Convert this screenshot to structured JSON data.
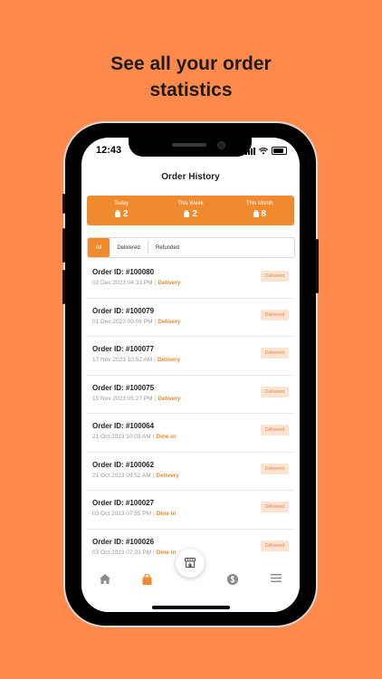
{
  "headline": {
    "line1": "See all your order",
    "line2": "statistics"
  },
  "status_bar": {
    "time": "12:43"
  },
  "page": {
    "title": "Order History"
  },
  "stats": [
    {
      "label": "Today",
      "value": "2"
    },
    {
      "label": "This Week",
      "value": "2"
    },
    {
      "label": "This Month",
      "value": "8"
    }
  ],
  "filter_tabs": [
    {
      "label": "All",
      "active": true
    },
    {
      "label": "Delivered",
      "active": false
    },
    {
      "label": "Refunded",
      "active": false
    }
  ],
  "orders": [
    {
      "id": "Order ID: #100080",
      "datetime": "02 Dec 2023  04:33 PM",
      "type": "Delivery",
      "status": "Delivered"
    },
    {
      "id": "Order ID: #100079",
      "datetime": "01 Dec 2023  09:06 PM",
      "type": "Delivery",
      "status": "Delivered"
    },
    {
      "id": "Order ID: #100077",
      "datetime": "17 Nov 2023  10:52 AM",
      "type": "Delivery",
      "status": "Delivered"
    },
    {
      "id": "Order ID: #100075",
      "datetime": "15 Nov 2023  05:27 PM",
      "type": "Delivery",
      "status": "Delivered"
    },
    {
      "id": "Order ID: #100064",
      "datetime": "21 Oct 2023  10:03 AM",
      "type": "Dine in",
      "status": "Delivered"
    },
    {
      "id": "Order ID: #100062",
      "datetime": "21 Oct 2023  09:52 AM",
      "type": "Delivery",
      "status": "Delivered"
    },
    {
      "id": "Order ID: #100027",
      "datetime": "03 Oct 2023  07:55 PM",
      "type": "Dine in",
      "status": "Delivered"
    },
    {
      "id": "Order ID: #100026",
      "datetime": "03 Oct 2023  07:33 PM",
      "type": "Dine in",
      "status": "Delivered"
    }
  ],
  "bottom_nav": [
    "home-icon",
    "shopping-bag-icon",
    "store-icon",
    "dollar-icon",
    "menu-icon"
  ],
  "colors": {
    "background": "#FF8A4C",
    "accent": "#F08A2F",
    "badge_bg": "#FDE3D2"
  }
}
